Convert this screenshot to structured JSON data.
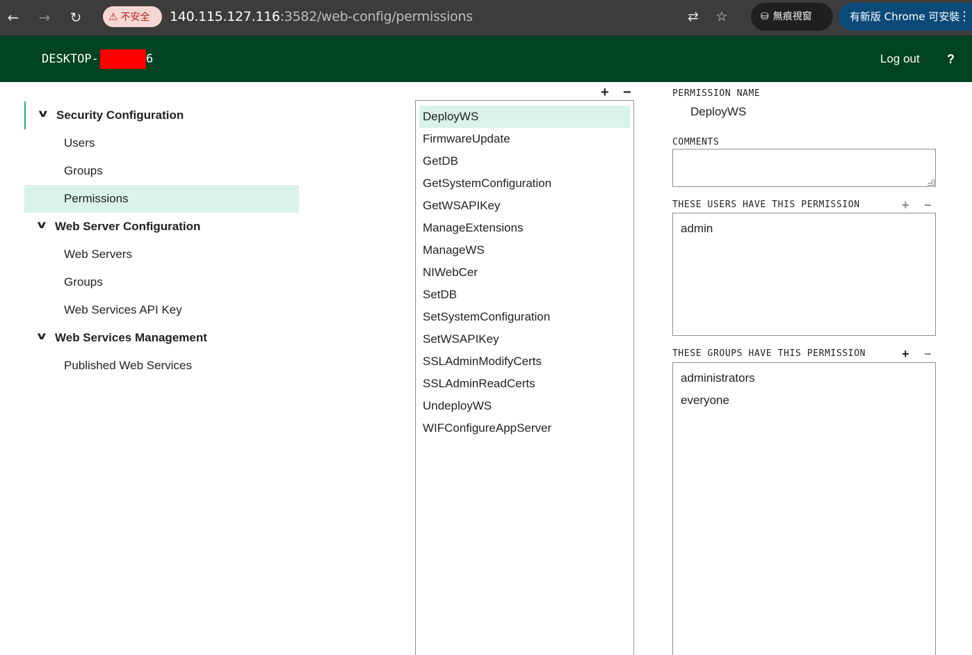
{
  "browser": {
    "security_label": "不安全",
    "url_host": "140.115.127.116",
    "url_port_path": ":3582/web-config/permissions",
    "incognito_label": "無痕視窗",
    "update_label": "有新版 Chrome 可安裝"
  },
  "header": {
    "hostname_prefix": "DESKTOP-",
    "hostname_suffix": "6",
    "logout_label": "Log out",
    "help_label": "?"
  },
  "sidebar": {
    "sections": [
      {
        "label": "Security Configuration",
        "items": [
          "Users",
          "Groups",
          "Permissions"
        ]
      },
      {
        "label": "Web Server Configuration",
        "items": [
          "Web Servers",
          "Groups",
          "Web Services API Key"
        ]
      },
      {
        "label": "Web Services Management",
        "items": [
          "Published Web Services"
        ]
      }
    ],
    "selected_item": "Permissions"
  },
  "permissions": {
    "items": [
      "DeployWS",
      "FirmwareUpdate",
      "GetDB",
      "GetSystemConfiguration",
      "GetWSAPIKey",
      "ManageExtensions",
      "ManageWS",
      "NIWebCer",
      "SetDB",
      "SetSystemConfiguration",
      "SetWSAPIKey",
      "SSLAdminModifyCerts",
      "SSLAdminReadCerts",
      "UndeployWS",
      "WIFConfigureAppServer"
    ],
    "selected": "DeployWS",
    "add_label": "+",
    "remove_label": "−"
  },
  "detail": {
    "permission_name_label": "PERMISSION NAME",
    "permission_name_value": "DeployWS",
    "comments_label": "COMMENTS",
    "comments_value": "",
    "users_label": "THESE USERS HAVE THIS PERMISSION",
    "users": [
      "admin"
    ],
    "groups_label": "THESE GROUPS HAVE THIS PERMISSION",
    "groups": [
      "administrators",
      "everyone"
    ]
  }
}
